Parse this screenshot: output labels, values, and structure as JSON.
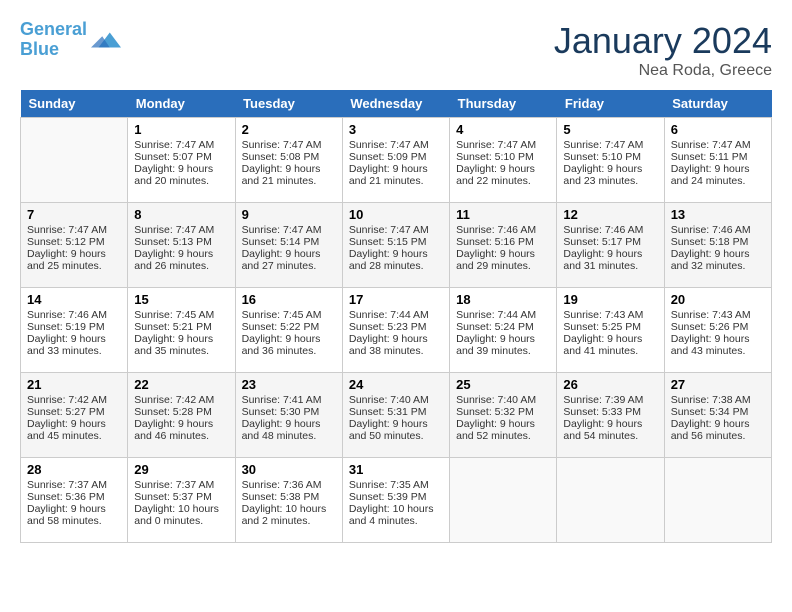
{
  "header": {
    "logo_line1": "General",
    "logo_line2": "Blue",
    "month": "January 2024",
    "location": "Nea Roda, Greece"
  },
  "days_of_week": [
    "Sunday",
    "Monday",
    "Tuesday",
    "Wednesday",
    "Thursday",
    "Friday",
    "Saturday"
  ],
  "weeks": [
    [
      {
        "day": "",
        "sunrise": "",
        "sunset": "",
        "daylight": ""
      },
      {
        "day": "1",
        "sunrise": "Sunrise: 7:47 AM",
        "sunset": "Sunset: 5:07 PM",
        "daylight": "Daylight: 9 hours and 20 minutes."
      },
      {
        "day": "2",
        "sunrise": "Sunrise: 7:47 AM",
        "sunset": "Sunset: 5:08 PM",
        "daylight": "Daylight: 9 hours and 21 minutes."
      },
      {
        "day": "3",
        "sunrise": "Sunrise: 7:47 AM",
        "sunset": "Sunset: 5:09 PM",
        "daylight": "Daylight: 9 hours and 21 minutes."
      },
      {
        "day": "4",
        "sunrise": "Sunrise: 7:47 AM",
        "sunset": "Sunset: 5:10 PM",
        "daylight": "Daylight: 9 hours and 22 minutes."
      },
      {
        "day": "5",
        "sunrise": "Sunrise: 7:47 AM",
        "sunset": "Sunset: 5:10 PM",
        "daylight": "Daylight: 9 hours and 23 minutes."
      },
      {
        "day": "6",
        "sunrise": "Sunrise: 7:47 AM",
        "sunset": "Sunset: 5:11 PM",
        "daylight": "Daylight: 9 hours and 24 minutes."
      }
    ],
    [
      {
        "day": "7",
        "sunrise": "Sunrise: 7:47 AM",
        "sunset": "Sunset: 5:12 PM",
        "daylight": "Daylight: 9 hours and 25 minutes."
      },
      {
        "day": "8",
        "sunrise": "Sunrise: 7:47 AM",
        "sunset": "Sunset: 5:13 PM",
        "daylight": "Daylight: 9 hours and 26 minutes."
      },
      {
        "day": "9",
        "sunrise": "Sunrise: 7:47 AM",
        "sunset": "Sunset: 5:14 PM",
        "daylight": "Daylight: 9 hours and 27 minutes."
      },
      {
        "day": "10",
        "sunrise": "Sunrise: 7:47 AM",
        "sunset": "Sunset: 5:15 PM",
        "daylight": "Daylight: 9 hours and 28 minutes."
      },
      {
        "day": "11",
        "sunrise": "Sunrise: 7:46 AM",
        "sunset": "Sunset: 5:16 PM",
        "daylight": "Daylight: 9 hours and 29 minutes."
      },
      {
        "day": "12",
        "sunrise": "Sunrise: 7:46 AM",
        "sunset": "Sunset: 5:17 PM",
        "daylight": "Daylight: 9 hours and 31 minutes."
      },
      {
        "day": "13",
        "sunrise": "Sunrise: 7:46 AM",
        "sunset": "Sunset: 5:18 PM",
        "daylight": "Daylight: 9 hours and 32 minutes."
      }
    ],
    [
      {
        "day": "14",
        "sunrise": "Sunrise: 7:46 AM",
        "sunset": "Sunset: 5:19 PM",
        "daylight": "Daylight: 9 hours and 33 minutes."
      },
      {
        "day": "15",
        "sunrise": "Sunrise: 7:45 AM",
        "sunset": "Sunset: 5:21 PM",
        "daylight": "Daylight: 9 hours and 35 minutes."
      },
      {
        "day": "16",
        "sunrise": "Sunrise: 7:45 AM",
        "sunset": "Sunset: 5:22 PM",
        "daylight": "Daylight: 9 hours and 36 minutes."
      },
      {
        "day": "17",
        "sunrise": "Sunrise: 7:44 AM",
        "sunset": "Sunset: 5:23 PM",
        "daylight": "Daylight: 9 hours and 38 minutes."
      },
      {
        "day": "18",
        "sunrise": "Sunrise: 7:44 AM",
        "sunset": "Sunset: 5:24 PM",
        "daylight": "Daylight: 9 hours and 39 minutes."
      },
      {
        "day": "19",
        "sunrise": "Sunrise: 7:43 AM",
        "sunset": "Sunset: 5:25 PM",
        "daylight": "Daylight: 9 hours and 41 minutes."
      },
      {
        "day": "20",
        "sunrise": "Sunrise: 7:43 AM",
        "sunset": "Sunset: 5:26 PM",
        "daylight": "Daylight: 9 hours and 43 minutes."
      }
    ],
    [
      {
        "day": "21",
        "sunrise": "Sunrise: 7:42 AM",
        "sunset": "Sunset: 5:27 PM",
        "daylight": "Daylight: 9 hours and 45 minutes."
      },
      {
        "day": "22",
        "sunrise": "Sunrise: 7:42 AM",
        "sunset": "Sunset: 5:28 PM",
        "daylight": "Daylight: 9 hours and 46 minutes."
      },
      {
        "day": "23",
        "sunrise": "Sunrise: 7:41 AM",
        "sunset": "Sunset: 5:30 PM",
        "daylight": "Daylight: 9 hours and 48 minutes."
      },
      {
        "day": "24",
        "sunrise": "Sunrise: 7:40 AM",
        "sunset": "Sunset: 5:31 PM",
        "daylight": "Daylight: 9 hours and 50 minutes."
      },
      {
        "day": "25",
        "sunrise": "Sunrise: 7:40 AM",
        "sunset": "Sunset: 5:32 PM",
        "daylight": "Daylight: 9 hours and 52 minutes."
      },
      {
        "day": "26",
        "sunrise": "Sunrise: 7:39 AM",
        "sunset": "Sunset: 5:33 PM",
        "daylight": "Daylight: 9 hours and 54 minutes."
      },
      {
        "day": "27",
        "sunrise": "Sunrise: 7:38 AM",
        "sunset": "Sunset: 5:34 PM",
        "daylight": "Daylight: 9 hours and 56 minutes."
      }
    ],
    [
      {
        "day": "28",
        "sunrise": "Sunrise: 7:37 AM",
        "sunset": "Sunset: 5:36 PM",
        "daylight": "Daylight: 9 hours and 58 minutes."
      },
      {
        "day": "29",
        "sunrise": "Sunrise: 7:37 AM",
        "sunset": "Sunset: 5:37 PM",
        "daylight": "Daylight: 10 hours and 0 minutes."
      },
      {
        "day": "30",
        "sunrise": "Sunrise: 7:36 AM",
        "sunset": "Sunset: 5:38 PM",
        "daylight": "Daylight: 10 hours and 2 minutes."
      },
      {
        "day": "31",
        "sunrise": "Sunrise: 7:35 AM",
        "sunset": "Sunset: 5:39 PM",
        "daylight": "Daylight: 10 hours and 4 minutes."
      },
      {
        "day": "",
        "sunrise": "",
        "sunset": "",
        "daylight": ""
      },
      {
        "day": "",
        "sunrise": "",
        "sunset": "",
        "daylight": ""
      },
      {
        "day": "",
        "sunrise": "",
        "sunset": "",
        "daylight": ""
      }
    ]
  ]
}
